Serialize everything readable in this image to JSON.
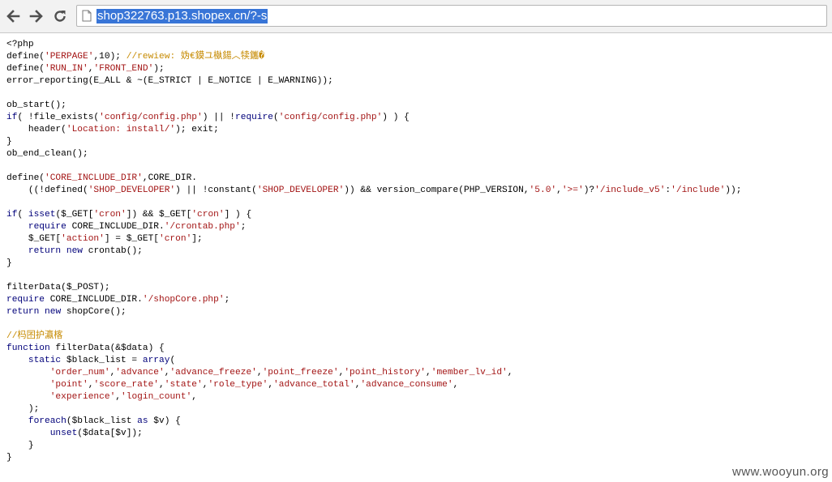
{
  "browser": {
    "url": "shop322763.p13.shopex.cn/?-s",
    "back_icon": "back-arrow-icon",
    "forward_icon": "forward-arrow-icon",
    "reload_icon": "reload-icon",
    "page_icon": "page-icon"
  },
  "code_lines": [
    "<?php",
    "define('PERPAGE',10); //rewiew: 妫€鏌ユ槸鍚︿犊鑴�",
    "define('RUN_IN','FRONT_END');",
    "error_reporting(E_ALL & ~(E_STRICT | E_NOTICE | E_WARNING));",
    "",
    "ob_start();",
    "if( !file_exists('config/config.php') || !require('config/config.php') ) {",
    "    header('Location: install/'); exit;",
    "}",
    "ob_end_clean();",
    "",
    "define('CORE_INCLUDE_DIR',CORE_DIR.",
    "    ((!defined('SHOP_DEVELOPER') || !constant('SHOP_DEVELOPER')) && version_compare(PHP_VERSION,'5.0','>=')?'/include_v5':'/include'));",
    "",
    "if( isset($_GET['cron']) && $_GET['cron'] ) {",
    "    require CORE_INCLUDE_DIR.'/crontab.php';",
    "    $_GET['action'] = $_GET['cron'];",
    "    return new crontab();",
    "}",
    "",
    "filterData($_POST);",
    "require CORE_INCLUDE_DIR.'/shopCore.php';",
    "return new shopCore();",
    "",
    "//杩囨护瀛楁",
    "function filterData(&$data) {",
    "    static $black_list = array(",
    "        'order_num','advance','advance_freeze','point_freeze','point_history','member_lv_id',",
    "        'point','score_rate','state','role_type','advance_total','advance_consume',",
    "        'experience','login_count',",
    "    );",
    "    foreach($black_list as $v) {",
    "        unset($data[$v]);",
    "    }",
    "}"
  ],
  "watermark": "www.wooyun.org"
}
